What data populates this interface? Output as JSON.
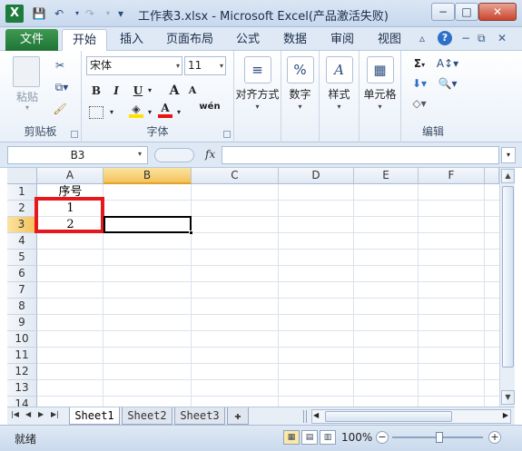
{
  "window": {
    "title": "工作表3.xlsx - Microsoft Excel(产品激活失败)",
    "minimize": "−",
    "maximize": "□",
    "close": "✕"
  },
  "qat": {
    "save_icon": "💾",
    "undo_icon": "↶",
    "redo_icon": "↷",
    "customize_icon": "▾"
  },
  "tabs": {
    "file": "文件",
    "items": [
      "开始",
      "插入",
      "页面布局",
      "公式",
      "数据",
      "审阅",
      "视图"
    ],
    "active_index": 0
  },
  "ribbon": {
    "clipboard": {
      "label": "剪贴板",
      "paste": "粘贴"
    },
    "font": {
      "label": "字体",
      "font_name": "宋体",
      "font_size": "11",
      "bold": "B",
      "italic": "I",
      "underline": "U",
      "grow": "A",
      "shrink": "A",
      "font_color": "A",
      "wen": "wén"
    },
    "alignment": {
      "label": "对齐方式"
    },
    "number": {
      "label": "数字",
      "icon": "%"
    },
    "styles": {
      "label": "样式"
    },
    "cells": {
      "label": "单元格"
    },
    "editing": {
      "label": "编辑",
      "sum": "Σ"
    }
  },
  "formula_bar": {
    "name_box": "B3",
    "fx": "fx",
    "value": ""
  },
  "grid": {
    "columns": [
      "A",
      "B",
      "C",
      "D",
      "E",
      "F"
    ],
    "rows": [
      "1",
      "2",
      "3",
      "4",
      "5",
      "6",
      "7",
      "8",
      "9",
      "10",
      "11",
      "12",
      "13",
      "14"
    ],
    "selected_column": "B",
    "selected_row": "3",
    "cells": {
      "A1": "序号",
      "A2": "1",
      "A3": "2"
    }
  },
  "sheets": {
    "tabs": [
      "Sheet1",
      "Sheet2",
      "Sheet3"
    ],
    "active_index": 0
  },
  "status": {
    "mode": "就绪",
    "zoom": "100%"
  },
  "colors": {
    "accent_green": "#1f7336",
    "selection_orange": "#f4c25c",
    "highlight_red": "#e5191c"
  }
}
